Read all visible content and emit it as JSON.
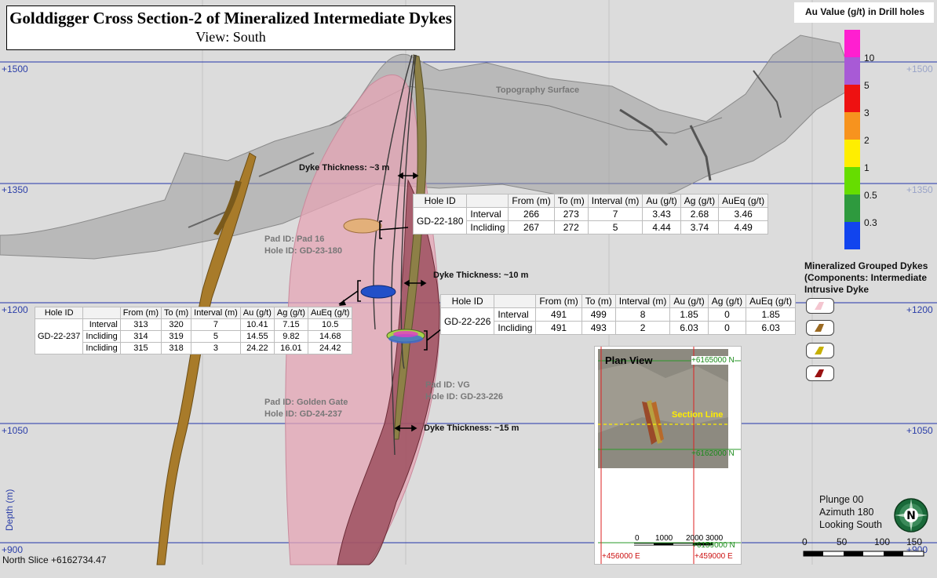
{
  "title": {
    "main": "Golddigger Cross Section-2 of Mineralized Intermediate Dykes",
    "view": "View: South"
  },
  "elevations": {
    "left": [
      "+1500",
      "+1350",
      "+1200",
      "+1050",
      "+900"
    ],
    "right": [
      "+1500",
      "+1350",
      "+1200",
      "+1050",
      "+900"
    ]
  },
  "depth_label": "Depth (m)",
  "north_slice": "North Slice +6162734.47",
  "topography_label": "Topography Surface",
  "dyke_thickness": [
    "Dyke Thickness: ~3 m",
    "Dyke Thickness: ~10 m",
    "Dyke Thickness: ~15 m"
  ],
  "pads": [
    {
      "pad": "Pad ID: Pad 16",
      "hole": "Hole ID: GD-23-180"
    },
    {
      "pad": "Pad ID: Golden Gate",
      "hole": "Hole ID: GD-24-237"
    },
    {
      "pad": "Pad ID: VG",
      "hole": "Hole ID: GD-23-226"
    }
  ],
  "tables": [
    {
      "id": "GD-22-180",
      "headers": [
        "Hole ID",
        "",
        "From (m)",
        "To (m)",
        "Interval (m)",
        "Au (g/t)",
        "Ag (g/t)",
        "AuEq (g/t)"
      ],
      "rows": [
        [
          "Interval",
          "266",
          "273",
          "7",
          "3.43",
          "2.68",
          "3.46"
        ],
        [
          "Incliding",
          "267",
          "272",
          "5",
          "4.44",
          "3.74",
          "4.49"
        ]
      ]
    },
    {
      "id": "GD-22-226",
      "headers": [
        "Hole ID",
        "",
        "From (m)",
        "To (m)",
        "Interval (m)",
        "Au (g/t)",
        "Ag (g/t)",
        "AuEq (g/t)"
      ],
      "rows": [
        [
          "Interval",
          "491",
          "499",
          "8",
          "1.85",
          "0",
          "1.85"
        ],
        [
          "Incliding",
          "491",
          "493",
          "2",
          "6.03",
          "0",
          "6.03"
        ]
      ]
    },
    {
      "id": "GD-22-237",
      "headers": [
        "Hole ID",
        "",
        "From (m)",
        "To (m)",
        "Interval (m)",
        "Au (g/t)",
        "Ag (g/t)",
        "AuEq (g/t)"
      ],
      "rows": [
        [
          "Interval",
          "313",
          "320",
          "7",
          "10.41",
          "7.15",
          "10.5"
        ],
        [
          "Incliding",
          "314",
          "319",
          "5",
          "14.55",
          "9.82",
          "14.68"
        ],
        [
          "Incliding",
          "315",
          "318",
          "3",
          "24.22",
          "16.01",
          "24.42"
        ]
      ]
    }
  ],
  "au_legend": {
    "title": "Au Value (g/t) in Drill holes",
    "values": [
      "10",
      "5",
      "3",
      "2",
      "1",
      "0.5",
      "0.3"
    ],
    "colors": [
      "#ff1fd0",
      "#a85ad6",
      "#ee1111",
      "#f7931e",
      "#ffee00",
      "#66dd00",
      "#2e9a3e",
      "#1144ee"
    ]
  },
  "dyke_legend": {
    "title_lines": [
      "Mineralized Grouped Dykes",
      "(Components: Intermediate",
      "Intrusive Dyke"
    ],
    "colors": [
      "#f4c6d0",
      "#9b6a22",
      "#c7b000",
      "#9a1212"
    ]
  },
  "plan_view": {
    "title": "Plan View",
    "north_top": "+6165000 N",
    "north_mid": "+6162000 N",
    "north_bot": "+6159000 N",
    "section_line": "Section Line",
    "east_left": "+456000 E",
    "east_right": "+459000 E",
    "scale": [
      "0",
      "1000",
      "2000",
      "3000"
    ]
  },
  "orientation": {
    "plunge": "Plunge 00",
    "azimuth": "Azimuth 180",
    "looking": "Looking South",
    "compass_letter": "N"
  },
  "scale_bar": [
    "0",
    "50",
    "100",
    "150"
  ]
}
